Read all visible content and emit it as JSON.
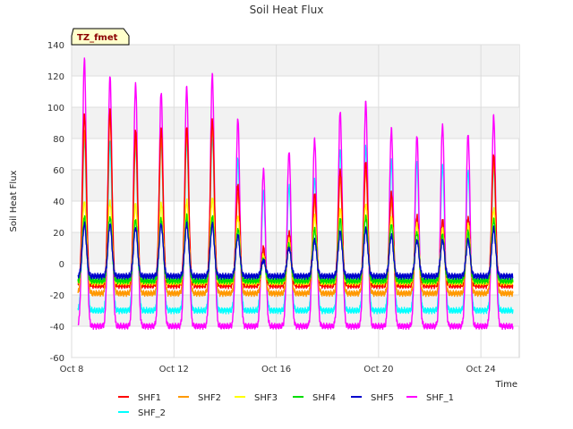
{
  "chart_data": {
    "type": "line",
    "title": "Soil Heat Flux",
    "xlabel": "Time",
    "ylabel": "Soil Heat Flux",
    "badge": "TZ_fmet",
    "xlim": [
      8.0,
      25.5
    ],
    "ylim": [
      -60,
      140
    ],
    "yticks": [
      -60,
      -40,
      -20,
      0,
      20,
      40,
      60,
      80,
      100,
      120,
      140
    ],
    "xticks": [
      {
        "value": 8,
        "label": "Oct 8"
      },
      {
        "value": 12,
        "label": "Oct 12"
      },
      {
        "value": 16,
        "label": "Oct 16"
      },
      {
        "value": 20,
        "label": "Oct 20"
      },
      {
        "value": 24,
        "label": "Oct 24"
      }
    ],
    "grid": true,
    "legend_placement": "bottom",
    "days": [
      8.5,
      9.5,
      10.5,
      11.5,
      12.5,
      13.5,
      14.5,
      15.5,
      16.5,
      17.5,
      18.5,
      19.5,
      20.5,
      21.5,
      22.5,
      23.5,
      24.5
    ],
    "start": 8.25,
    "end": 25.25,
    "series": [
      {
        "name": "SHF1",
        "color": "#ff0000",
        "peaks": [
          95,
          98,
          85,
          86,
          88,
          92,
          50,
          10,
          20,
          45,
          60,
          65,
          45,
          30,
          28,
          30,
          70
        ],
        "night": -14
      },
      {
        "name": "SHF2",
        "color": "#ff9900",
        "peaks": [
          85,
          95,
          80,
          80,
          84,
          88,
          45,
          8,
          18,
          40,
          55,
          60,
          40,
          27,
          25,
          28,
          65
        ],
        "night": -19
      },
      {
        "name": "SHF3",
        "color": "#ffff00",
        "peaks": [
          40,
          40,
          38,
          38,
          40,
          42,
          30,
          5,
          15,
          30,
          35,
          38,
          30,
          25,
          22,
          25,
          35
        ],
        "night": -12
      },
      {
        "name": "SHF4",
        "color": "#00dd00",
        "peaks": [
          30,
          30,
          28,
          28,
          30,
          30,
          22,
          3,
          12,
          22,
          28,
          30,
          25,
          20,
          18,
          20,
          28
        ],
        "night": -11
      },
      {
        "name": "SHF5",
        "color": "#0000cc",
        "peaks": [
          25,
          25,
          23,
          25,
          25,
          25,
          18,
          2,
          10,
          15,
          20,
          22,
          18,
          15,
          15,
          15,
          22
        ],
        "night": -8
      },
      {
        "name": "SHF_1",
        "color": "#ff00ff",
        "peaks": [
          130,
          120,
          115,
          110,
          113,
          121,
          92,
          60,
          72,
          80,
          97,
          103,
          86,
          82,
          89,
          83,
          94
        ],
        "night": -40
      },
      {
        "name": "SHF_2",
        "color": "#00ffff",
        "peaks": [
          80,
          78,
          76,
          78,
          78,
          82,
          67,
          45,
          50,
          55,
          73,
          75,
          65,
          65,
          63,
          60,
          62
        ],
        "night": -30
      }
    ]
  }
}
